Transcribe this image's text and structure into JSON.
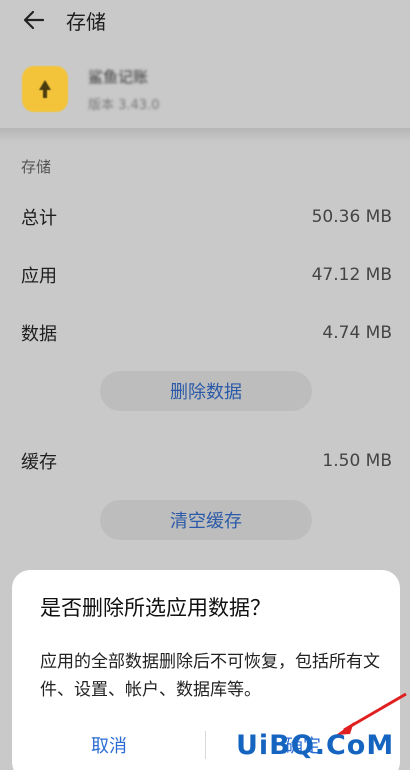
{
  "header": {
    "title": "存储"
  },
  "app": {
    "name": "鲨鱼记账",
    "version": "版本 3.43.0"
  },
  "storage": {
    "section_label": "存储",
    "rows": [
      {
        "label": "总计",
        "value": "50.36 MB"
      },
      {
        "label": "应用",
        "value": "47.12 MB"
      },
      {
        "label": "数据",
        "value": "4.74 MB"
      }
    ],
    "delete_data_button": "删除数据",
    "cache": {
      "label": "缓存",
      "value": "1.50 MB"
    },
    "clear_cache_button": "清空缓存"
  },
  "dialog": {
    "title": "是否删除所选应用数据？",
    "message": "应用的全部数据删除后不可恢复，包括所有文件、设置、帐户、数据库等。",
    "cancel": "取消",
    "confirm": "确定"
  },
  "watermark": "UiBQ.CoM",
  "colors": {
    "accent": "#2b6cd4",
    "app_icon": "#f3c43a",
    "annotation": "#e02020"
  }
}
